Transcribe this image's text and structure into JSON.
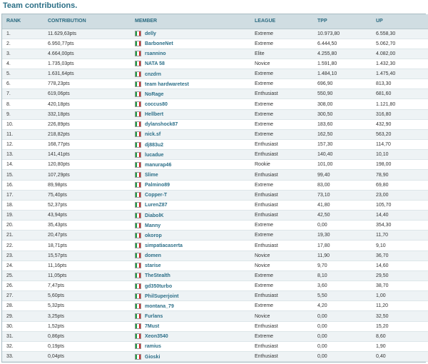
{
  "page_title": "Team contributions.",
  "columns": [
    "RANK",
    "CONTRIBUTION",
    "MEMBER",
    "LEAGUE",
    "TPP",
    "UP"
  ],
  "flag_colors": [
    "#1c9a3e",
    "#ffffff",
    "#d42a2a"
  ],
  "rows": [
    {
      "rank": "1.",
      "contribution": "11.629,63pts",
      "member": "delly",
      "league": "Extreme",
      "tpp": "10.973,80",
      "up": "6.558,30"
    },
    {
      "rank": "2.",
      "contribution": "6.950,77pts",
      "member": "BarboneNet",
      "league": "Extreme",
      "tpp": "6.444,50",
      "up": "5.062,70"
    },
    {
      "rank": "3.",
      "contribution": "4.664,00pts",
      "member": "rsannino",
      "league": "Elite",
      "tpp": "4.255,80",
      "up": "4.082,00"
    },
    {
      "rank": "4.",
      "contribution": "1.735,03pts",
      "member": "NATA 58",
      "league": "Novice",
      "tpp": "1.591,80",
      "up": "1.432,30"
    },
    {
      "rank": "5.",
      "contribution": "1.631,64pts",
      "member": "cnzdrn",
      "league": "Extreme",
      "tpp": "1.484,10",
      "up": "1.475,40"
    },
    {
      "rank": "6.",
      "contribution": "778,23pts",
      "member": "team hardwaretest",
      "league": "Extreme",
      "tpp": "696,90",
      "up": "813,30"
    },
    {
      "rank": "7.",
      "contribution": "619,06pts",
      "member": "NoRage",
      "league": "Enthusiast",
      "tpp": "550,90",
      "up": "681,60"
    },
    {
      "rank": "8.",
      "contribution": "420,18pts",
      "member": "coccus80",
      "league": "Extreme",
      "tpp": "308,00",
      "up": "1.121,80"
    },
    {
      "rank": "9.",
      "contribution": "332,18pts",
      "member": "Hellbert",
      "league": "Extreme",
      "tpp": "300,50",
      "up": "316,80"
    },
    {
      "rank": "10.",
      "contribution": "226,89pts",
      "member": "dylanshock87",
      "league": "Extreme",
      "tpp": "183,60",
      "up": "432,90"
    },
    {
      "rank": "11.",
      "contribution": "218,82pts",
      "member": "nick.sf",
      "league": "Extreme",
      "tpp": "162,50",
      "up": "563,20"
    },
    {
      "rank": "12.",
      "contribution": "168,77pts",
      "member": "dj883u2",
      "league": "Enthusiast",
      "tpp": "157,30",
      "up": "114,70"
    },
    {
      "rank": "13.",
      "contribution": "141,41pts",
      "member": "lucadue",
      "league": "Enthusiast",
      "tpp": "140,40",
      "up": "10,10"
    },
    {
      "rank": "14.",
      "contribution": "120,80pts",
      "member": "manurap46",
      "league": "Rookie",
      "tpp": "101,00",
      "up": "198,00"
    },
    {
      "rank": "15.",
      "contribution": "107,29pts",
      "member": "Slime",
      "league": "Enthusiast",
      "tpp": "99,40",
      "up": "78,90"
    },
    {
      "rank": "16.",
      "contribution": "89,98pts",
      "member": "Palmino89",
      "league": "Extreme",
      "tpp": "83,00",
      "up": "69,80"
    },
    {
      "rank": "17.",
      "contribution": "75,40pts",
      "member": "Copper-T",
      "league": "Enthusiast",
      "tpp": "73,10",
      "up": "23,00"
    },
    {
      "rank": "18.",
      "contribution": "52,37pts",
      "member": "LurenZ87",
      "league": "Enthusiast",
      "tpp": "41,80",
      "up": "105,70"
    },
    {
      "rank": "19.",
      "contribution": "43,94pts",
      "member": "DiabolK",
      "league": "Enthusiast",
      "tpp": "42,50",
      "up": "14,40"
    },
    {
      "rank": "20.",
      "contribution": "35,43pts",
      "member": "Manny",
      "league": "Extreme",
      "tpp": "0,00",
      "up": "354,30"
    },
    {
      "rank": "21.",
      "contribution": "20,47pts",
      "member": "okorop",
      "league": "Extreme",
      "tpp": "19,30",
      "up": "11,70"
    },
    {
      "rank": "22.",
      "contribution": "18,71pts",
      "member": "simpatiacaserta",
      "league": "Enthusiast",
      "tpp": "17,80",
      "up": "9,10"
    },
    {
      "rank": "23.",
      "contribution": "15,57pts",
      "member": "domen",
      "league": "Novice",
      "tpp": "11,90",
      "up": "36,70"
    },
    {
      "rank": "24.",
      "contribution": "11,16pts",
      "member": "starise",
      "league": "Novice",
      "tpp": "9,70",
      "up": "14,60"
    },
    {
      "rank": "25.",
      "contribution": "11,05pts",
      "member": "TheStealth",
      "league": "Extreme",
      "tpp": "8,10",
      "up": "29,50"
    },
    {
      "rank": "26.",
      "contribution": "7,47pts",
      "member": "gd350turbo",
      "league": "Extreme",
      "tpp": "3,60",
      "up": "38,70"
    },
    {
      "rank": "27.",
      "contribution": "5,60pts",
      "member": "PhilSuperjoint",
      "league": "Enthusiast",
      "tpp": "5,50",
      "up": "1,00"
    },
    {
      "rank": "28.",
      "contribution": "5,32pts",
      "member": "montana_79",
      "league": "Extreme",
      "tpp": "4,20",
      "up": "11,20"
    },
    {
      "rank": "29.",
      "contribution": "3,25pts",
      "member": "Furlans",
      "league": "Novice",
      "tpp": "0,00",
      "up": "32,50"
    },
    {
      "rank": "30.",
      "contribution": "1,52pts",
      "member": "7Must",
      "league": "Enthusiast",
      "tpp": "0,00",
      "up": "15,20"
    },
    {
      "rank": "31.",
      "contribution": "0,86pts",
      "member": "Xeon3540",
      "league": "Extreme",
      "tpp": "0,00",
      "up": "8,60"
    },
    {
      "rank": "32.",
      "contribution": "0,19pts",
      "member": "ramius",
      "league": "Enthusiast",
      "tpp": "0,00",
      "up": "1,90"
    },
    {
      "rank": "33.",
      "contribution": "0,04pts",
      "member": "Gioski",
      "league": "Enthusiast",
      "tpp": "0,00",
      "up": "0,40"
    }
  ]
}
